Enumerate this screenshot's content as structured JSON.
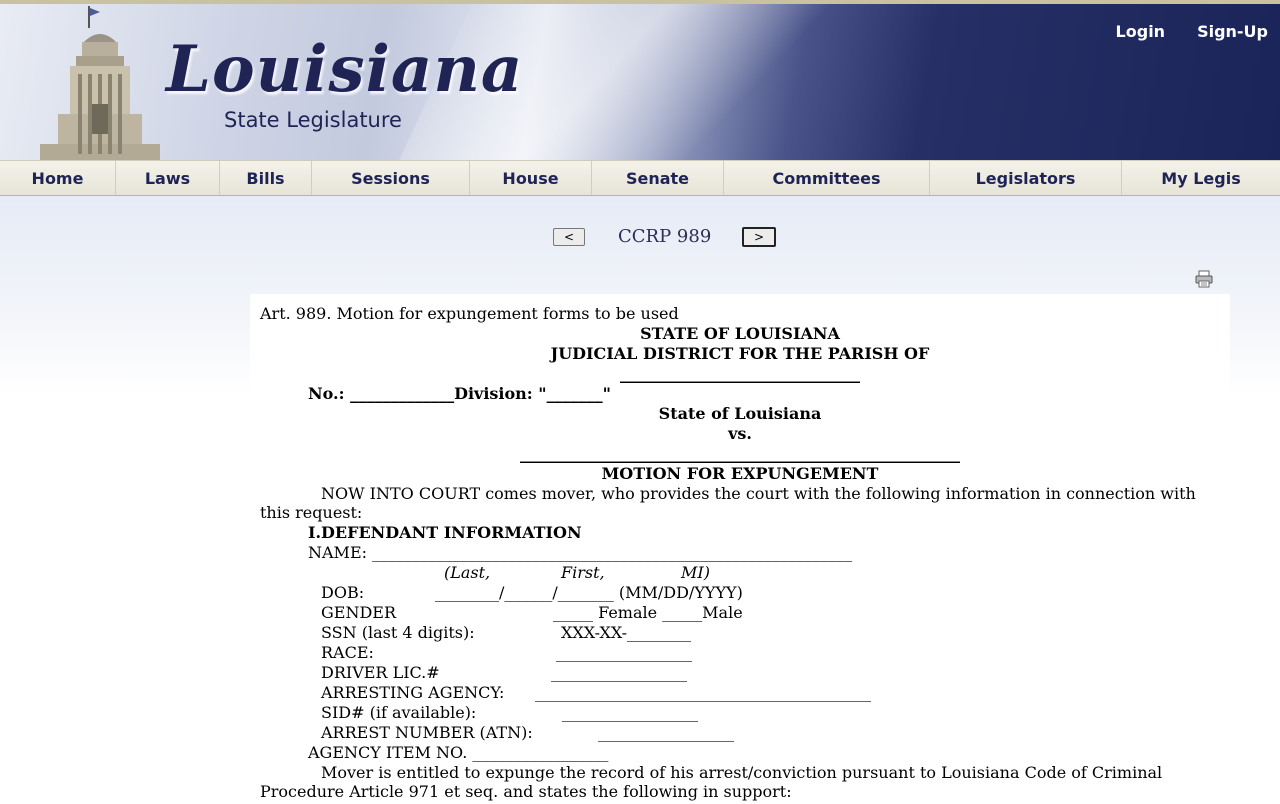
{
  "header": {
    "logo_main": "Louisiana",
    "logo_sub": "State Legislature",
    "login": "Login",
    "signup": "Sign-Up"
  },
  "nav": {
    "items": [
      "Home",
      "Laws",
      "Bills",
      "Sessions",
      "House",
      "Senate",
      "Committees",
      "Legislators",
      "My Legis"
    ]
  },
  "doc_nav": {
    "prev_label": "<",
    "title": "CCRP 989",
    "next_label": ">"
  },
  "document": {
    "article": "Art. 989. Motion for expungement forms to be used",
    "state": "STATE OF LOUISIANA",
    "district": "JUDICIAL DISTRICT FOR THE PARISH OF",
    "blank1": "______________________________",
    "no_division": "No.: _____________Division: \"_______\"",
    "state_case": "State of Louisiana",
    "vs": "vs.",
    "blank2": "_______________________________________________________",
    "motion_title": "MOTION FOR EXPUNGEMENT",
    "now_into_court": "NOW INTO COURT comes mover, who provides the court with the following information in connection with",
    "this_request": "this request:",
    "section1": "I.DEFENDANT INFORMATION",
    "name_label": "NAME: ____________________________________________________________",
    "name_hint_last": "(Last,",
    "name_hint_first": "First,",
    "name_hint_mi": "MI)",
    "dob_label": "DOB:",
    "dob_value": "________/______/_______ (MM/DD/YYYY)",
    "gender_label": "GENDER",
    "gender_value": "_____ Female _____Male",
    "ssn_label": "SSN (last 4 digits):",
    "ssn_value": "XXX-XX-________",
    "race_label": "RACE:",
    "race_value": "_________________",
    "driver_label": "DRIVER LIC.#",
    "driver_value": "_________________",
    "agency_label": "ARRESTING AGENCY:",
    "agency_value": "__________________________________________",
    "sid_label": "SID# (if available):",
    "sid_value": "_________________",
    "atn_label": "ARREST NUMBER (ATN):",
    "atn_value": "_________________",
    "agency_item": "AGENCY ITEM NO. _________________",
    "mover_line1": "Mover is entitled to expunge the record of his arrest/conviction pursuant to Louisiana Code of Criminal",
    "mover_line2": "Procedure Article 971 et seq. and states the following in support:"
  }
}
